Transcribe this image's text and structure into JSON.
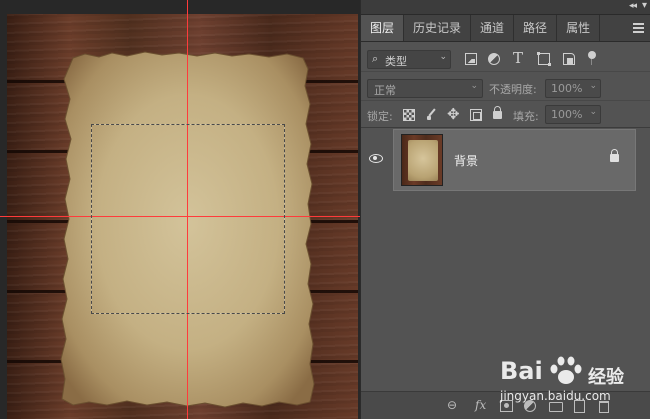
{
  "panel": {
    "tabs": [
      {
        "label": "图层",
        "active": true
      },
      {
        "label": "历史记录",
        "active": false
      },
      {
        "label": "通道",
        "active": false
      },
      {
        "label": "路径",
        "active": false
      },
      {
        "label": "属性",
        "active": false
      }
    ],
    "filter": {
      "kind_label": "类型",
      "search_glyph": "⌕"
    },
    "blend_mode": "正常",
    "opacity_label": "不透明度:",
    "opacity_value": "100%",
    "lock_label": "锁定:",
    "fill_label": "填充:",
    "fill_value": "100%",
    "layers": [
      {
        "name": "背景",
        "visible": true,
        "locked": true,
        "selected": true
      }
    ],
    "bottom_icons": [
      "link-icon",
      "fx-icon",
      "mask-icon",
      "adjustment-icon",
      "folder-icon",
      "new-layer-icon",
      "trash-icon"
    ],
    "fx_label": "fx",
    "link_glyph": "⊖"
  },
  "window": {
    "collapse_glyph": "◂◂",
    "close_glyph": "▾"
  },
  "watermark": {
    "brand": "Bai",
    "brand_suffix": "经验",
    "url": "jingyan.baidu.com"
  },
  "colors": {
    "guide": "#ff3b3b",
    "panel_bg": "#535353",
    "selected_row": "#696969"
  }
}
